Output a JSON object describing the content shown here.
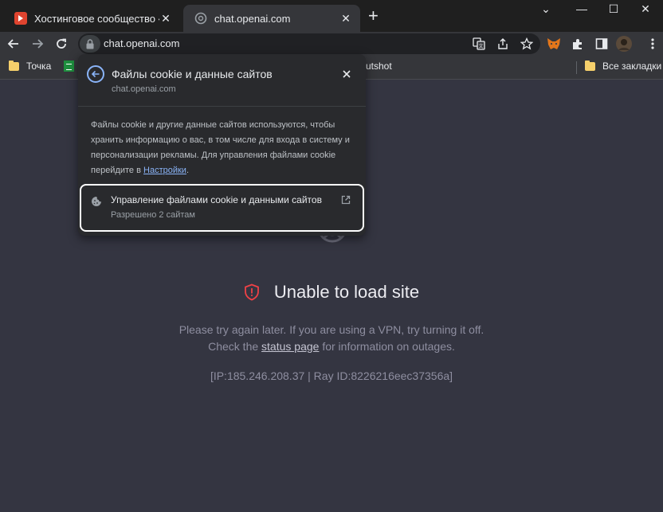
{
  "tabs": [
    {
      "title": "Хостинговое сообщество «Time",
      "close": "✕",
      "favicon_color": "#e0442f"
    },
    {
      "title": "chat.openai.com",
      "close": "✕",
      "favicon_color": "#9aa0a6"
    }
  ],
  "window": {
    "newtab": "+",
    "minimize": "⌄",
    "restore": "—",
    "maximize": "☐",
    "close": "✕"
  },
  "address": {
    "url": "chat.openai.com"
  },
  "bookmarks": [
    {
      "label": "Точка",
      "icon": "folder-icon"
    },
    {
      "label": "",
      "icon": "sheets-icon"
    },
    {
      "label": "utshot",
      "icon": ""
    },
    {
      "label": "Все закладки",
      "icon": "folder-icon"
    }
  ],
  "popup": {
    "title": "Файлы cookie и данные сайтов",
    "subtitle": "chat.openai.com",
    "body_text": "Файлы cookie и другие данные сайтов используются, чтобы хранить информацию о вас, в том числе для входа в систему и персонализации рекламы. Для управления файлами cookie перейдите в ",
    "body_link": "Настройки",
    "body_end": ".",
    "manage_title": "Управление файлами cookie и данными сайтов",
    "manage_subtitle": "Разрешено 2 сайтам"
  },
  "error": {
    "title": "Unable to load site",
    "line1": "Please try again later. If you are using a VPN, try turning it off.",
    "line2_prefix": "Check the ",
    "line2_link": "status page",
    "line2_suffix": " for information on outages.",
    "ray": "[IP:185.246.208.37 | Ray ID:8226216eec37356a]"
  },
  "colors": {
    "accent": "#8ab4f8",
    "error_icon": "#ef4146",
    "page_bg": "#343541"
  }
}
